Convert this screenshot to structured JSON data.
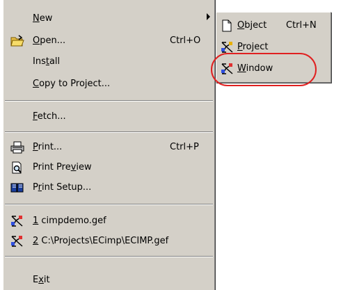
{
  "file_menu": {
    "items": [
      {
        "label_pre": "",
        "label_u": "N",
        "label_post": "ew",
        "shortcut": "",
        "icon": "none",
        "has_submenu": true
      },
      {
        "label_pre": "",
        "label_u": "O",
        "label_post": "pen...",
        "shortcut": "Ctrl+O",
        "icon": "open-folder-icon"
      },
      {
        "label_pre": "Ins",
        "label_u": "t",
        "label_post": "all",
        "shortcut": "",
        "icon": "none"
      },
      {
        "label_pre": "",
        "label_u": "C",
        "label_post": "opy to Project...",
        "shortcut": "",
        "icon": "none"
      },
      {
        "label_pre": "",
        "label_u": "F",
        "label_post": "etch...",
        "shortcut": "",
        "icon": "none"
      },
      {
        "label_pre": "",
        "label_u": "P",
        "label_post": "rint...",
        "shortcut": "Ctrl+P",
        "icon": "printer-icon"
      },
      {
        "label_pre": "Print Pre",
        "label_u": "v",
        "label_post": "iew",
        "shortcut": "",
        "icon": "print-preview-icon"
      },
      {
        "label_pre": "P",
        "label_u": "r",
        "label_post": "int Setup...",
        "shortcut": "",
        "icon": "print-setup-icon"
      },
      {
        "label_pre": "",
        "label_u": "1",
        "label_post": " cimpdemo.gef",
        "shortcut": "",
        "icon": "gef-file-icon"
      },
      {
        "label_pre": "",
        "label_u": "2",
        "label_post": " C:\\Projects\\ECimp\\ECIMP.gef",
        "shortcut": "",
        "icon": "gef-file-icon"
      },
      {
        "label_pre": "E",
        "label_u": "x",
        "label_post": "it",
        "shortcut": "",
        "icon": "none"
      }
    ]
  },
  "new_submenu": {
    "items": [
      {
        "label_pre": "",
        "label_u": "O",
        "label_post": "bject",
        "shortcut": "Ctrl+N",
        "icon": "document-icon"
      },
      {
        "label_pre": "",
        "label_u": "P",
        "label_post": "roject",
        "shortcut": "",
        "icon": "project-icon"
      },
      {
        "label_pre": "",
        "label_u": "W",
        "label_post": "indow",
        "shortcut": "",
        "icon": "window-icon"
      }
    ]
  },
  "colors": {
    "menu_bg": "#d4d0c8",
    "highlight_circle": "#e02020"
  }
}
